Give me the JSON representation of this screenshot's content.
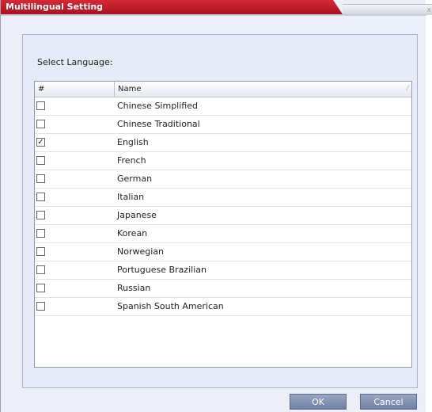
{
  "window": {
    "title": "Multilingual Setting",
    "close_glyph": "x"
  },
  "panel": {
    "select_label": "Select Language:"
  },
  "grid": {
    "columns": {
      "num": "#",
      "name": "Name",
      "sort_glyph": "⁄"
    },
    "rows": [
      {
        "checked": false,
        "name": "Chinese Simplified"
      },
      {
        "checked": false,
        "name": "Chinese Traditional"
      },
      {
        "checked": true,
        "name": "English"
      },
      {
        "checked": false,
        "name": "French"
      },
      {
        "checked": false,
        "name": "German"
      },
      {
        "checked": false,
        "name": "Italian"
      },
      {
        "checked": false,
        "name": "Japanese"
      },
      {
        "checked": false,
        "name": "Korean"
      },
      {
        "checked": false,
        "name": "Norwegian"
      },
      {
        "checked": false,
        "name": "Portuguese Brazilian"
      },
      {
        "checked": false,
        "name": "Russian"
      },
      {
        "checked": false,
        "name": "Spanish South American"
      }
    ]
  },
  "buttons": {
    "ok": "OK",
    "cancel": "Cancel"
  },
  "colors": {
    "title_red": "#b71c26",
    "button_blue": "#7d8cae"
  }
}
